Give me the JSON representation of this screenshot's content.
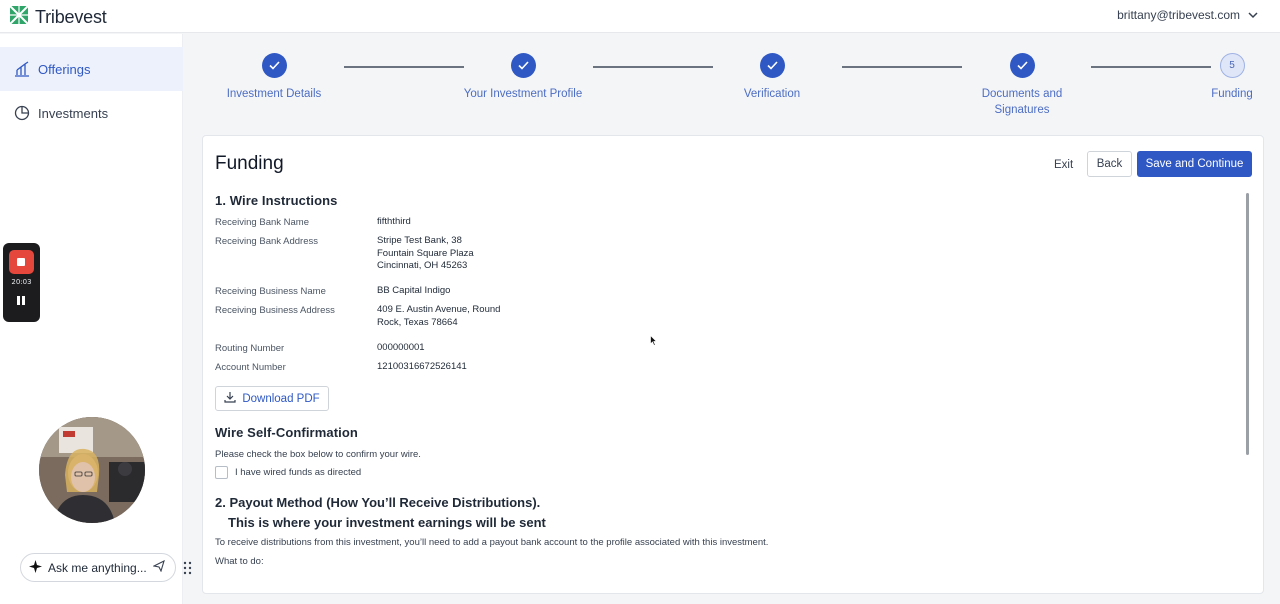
{
  "brand": {
    "name": "Tribevest"
  },
  "user": {
    "email": "brittany@tribevest.com"
  },
  "sidebar": {
    "items": [
      {
        "label": "Offerings",
        "icon": "bar-chart-icon",
        "active": true
      },
      {
        "label": "Investments",
        "icon": "pie-chart-icon",
        "active": false
      }
    ]
  },
  "recorder": {
    "time": "20:03"
  },
  "assistant": {
    "placeholder": "Ask me anything..."
  },
  "stepper": {
    "steps": [
      {
        "label": "Investment Details",
        "status": "complete"
      },
      {
        "label": "Your Investment Profile",
        "status": "complete"
      },
      {
        "label": "Verification",
        "status": "complete"
      },
      {
        "label": "Documents and Signatures",
        "status": "complete"
      },
      {
        "label": "Funding",
        "status": "current",
        "number": "5"
      }
    ]
  },
  "page": {
    "title": "Funding",
    "actions": {
      "exit": "Exit",
      "back": "Back",
      "save": "Save and Continue"
    }
  },
  "wire": {
    "title": "1. Wire Instructions",
    "rows": [
      {
        "label": "Receiving Bank Name",
        "value": "fifththird"
      },
      {
        "label": "Receiving Bank Address",
        "value": "Stripe Test Bank, 38\nFountain Square Plaza\nCincinnati, OH 45263"
      },
      {
        "label": "Receiving Business Name",
        "value": "BB Capital Indigo"
      },
      {
        "label": "Receiving Business Address",
        "value": "409 E. Austin Avenue, Round\nRock, Texas 78664"
      },
      {
        "label": "Routing Number",
        "value": "000000001"
      },
      {
        "label": "Account Number",
        "value": "12100316672526141"
      }
    ],
    "download_label": "Download PDF"
  },
  "confirmation": {
    "title": "Wire Self-Confirmation",
    "instruction": "Please check the box below to confirm your wire.",
    "checkbox_label": "I have wired funds as directed",
    "checked": false
  },
  "payout": {
    "title_line1": "2. Payout Method (How You’ll Receive Distributions).",
    "title_line2": "This is where your investment earnings will be sent",
    "description": "To receive distributions from this investment, you’ll need to add a payout bank account to the profile associated with this investment.",
    "what_to_do": "What to do:"
  },
  "colors": {
    "accent": "#2f58c4",
    "record": "#e5473d",
    "logo_green": "#2fa56a"
  }
}
